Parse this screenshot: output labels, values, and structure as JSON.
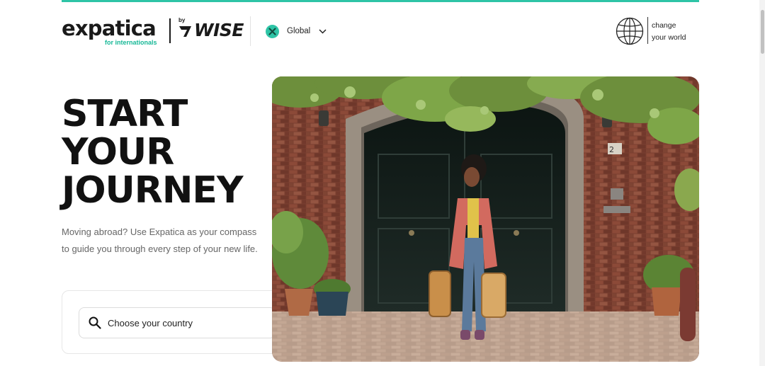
{
  "brand": {
    "logo": "expatica",
    "tagline": "for internationals",
    "by": "by",
    "partner": "WISE",
    "accent_color": "#2ec4a6"
  },
  "header": {
    "region": {
      "label": "Global",
      "icon": "region-badge-icon"
    },
    "world_link": {
      "line1": "change",
      "line2": "your world",
      "icon": "globe-icon"
    }
  },
  "hero": {
    "title_lines": [
      "START",
      "YOUR",
      "JOURNEY"
    ],
    "description": "Moving abroad? Use Expatica as your compass to guide you through every step of your new life.",
    "search": {
      "placeholder": "Choose your country",
      "icon": "search-icon"
    },
    "photo": "woman-with-suitcases-at-brick-doorway"
  }
}
